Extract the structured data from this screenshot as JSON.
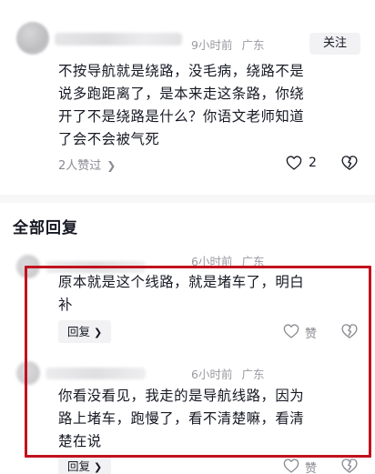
{
  "top_comment": {
    "time": "9小时前",
    "location": "广东",
    "follow_label": "关注",
    "lines": [
      "不按导航就是绕路，没毛病，绕路不是",
      "说多跑距离了，是本来走这条路，你绕",
      "开了不是绕路是什么？你语文老师知道",
      "了会不会被气死"
    ],
    "likers_label": "2人赞过",
    "like_count": "2"
  },
  "replies_section": {
    "title": "全部回复"
  },
  "replies": [
    {
      "time": "6小时前",
      "location": "广东",
      "lines": [
        "原本就是这个线路，就是堵车了，明白",
        "补"
      ],
      "reply_label": "回复",
      "like_label": "赞"
    },
    {
      "time": "6小时前",
      "location": "广东",
      "lines": [
        "你看没看见，我走的是导航线路，因为",
        "路上堵车，跑慢了，看不清楚嘛，看清",
        "楚在说"
      ],
      "reply_label": "回复",
      "like_label": "赞"
    }
  ],
  "colors": {
    "highlight": "#c1121f",
    "text_primary": "#161823",
    "text_secondary": "#9a9aa1"
  },
  "icons": [
    "heart-icon",
    "dislike-heart-icon",
    "chevron-right-icon"
  ]
}
